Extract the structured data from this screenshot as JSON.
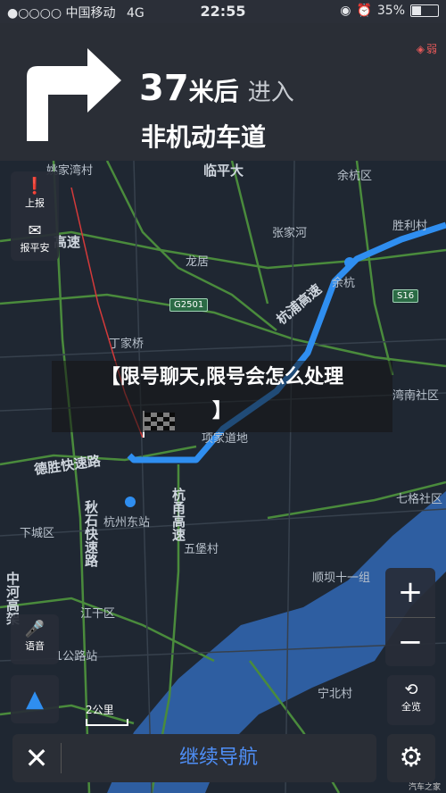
{
  "status": {
    "carrier": "●○○○○ 中国移动",
    "network": "4G",
    "time": "22:55",
    "battery": "35%",
    "battery_level": 0.35
  },
  "nav": {
    "distance_num": "37",
    "distance_unit": "米后",
    "action": "进入",
    "road": "非机动车道",
    "signal": "弱"
  },
  "controls": {
    "report": "上报",
    "safe": "报平安",
    "voice": "语音",
    "overview": "全览",
    "zoom_in": "+",
    "zoom_out": "−",
    "scale": "2公里",
    "continue": "继续导航",
    "close": "✕",
    "settings": "⚙"
  },
  "banner": {
    "line1": "【限号聊天,限号会怎么处理",
    "line2": "】"
  },
  "map_labels": {
    "l1": "姚家湾村",
    "l2": "临平大",
    "l3": "余杭区",
    "l4": "张家河",
    "l5": "胜利村",
    "l6": "高速",
    "l7": "龙居",
    "l8": "余杭",
    "l9": "杭浦高速",
    "l10": "丁家桥",
    "l11": "湾南社区",
    "l12": "项家道地",
    "l13": "德胜快速路",
    "l14": "秋石快速路",
    "l15": "杭州东站",
    "l16": "杭甬高速",
    "l17": "五堡村",
    "l18": "七格社区",
    "l19": "下城区",
    "l20": "顺坝十一组",
    "l21": "江干区",
    "l22": "中河高架",
    "l23": "宁北村",
    "s1": "G2501",
    "s2": "S16",
    "l24": "1公路站"
  },
  "watermark": "汽车之家"
}
